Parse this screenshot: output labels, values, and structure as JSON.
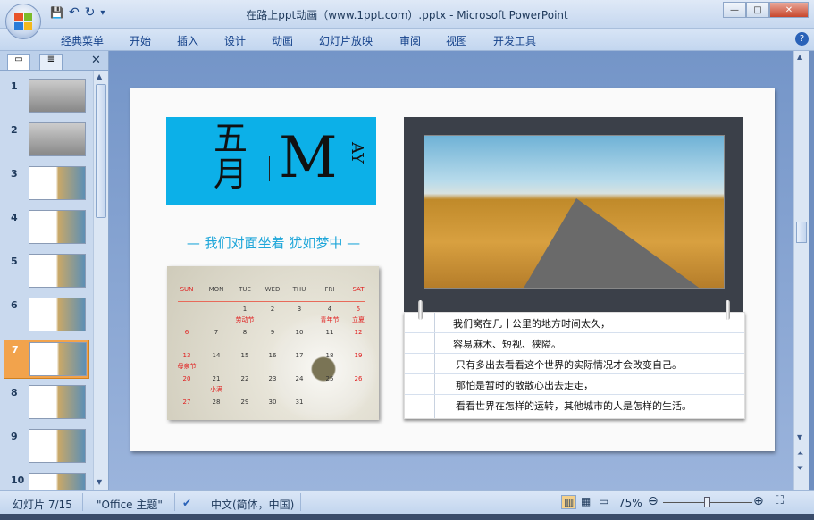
{
  "window": {
    "title": "在路上ppt动画（www.1ppt.com）.pptx - Microsoft PowerPoint",
    "minimize": "—",
    "maximize": "□",
    "close": "✕"
  },
  "qat": {
    "save": "💾",
    "undo": "↶",
    "redo": "↻",
    "more": "▾"
  },
  "ribbon": {
    "tabs": [
      "经典菜单",
      "开始",
      "插入",
      "设计",
      "动画",
      "幻灯片放映",
      "审阅",
      "视图",
      "开发工具"
    ],
    "help": "?"
  },
  "slides_pane": {
    "close": "✕",
    "selected": 7,
    "numbers": [
      "1",
      "2",
      "3",
      "4",
      "5",
      "6",
      "7",
      "8",
      "9",
      "10"
    ]
  },
  "slide": {
    "month_cn": "五月",
    "month_en_big": "M",
    "month_en_small": "AY",
    "tagline": "— 我们对面坐着 犹如梦中 —",
    "calendar": {
      "headers": [
        "SUN",
        "MON",
        "TUE",
        "WED",
        "THU",
        "FRI",
        "SAT"
      ],
      "weeks": [
        [
          "",
          "",
          "1",
          "2",
          "3",
          "4",
          "5"
        ],
        [
          "6",
          "7",
          "8",
          "9",
          "10",
          "11",
          "12"
        ],
        [
          "13",
          "14",
          "15",
          "16",
          "17",
          "18",
          "19"
        ],
        [
          "20",
          "21",
          "22",
          "23",
          "24",
          "25",
          "26"
        ],
        [
          "27",
          "28",
          "29",
          "30",
          "31",
          "",
          ""
        ]
      ],
      "holidays": [
        {
          "day": "1",
          "name": "劳动节"
        },
        {
          "day": "4",
          "name": "青年节"
        },
        {
          "day": "5",
          "name": "立夏"
        },
        {
          "day": "13",
          "name": "母亲节"
        },
        {
          "day": "21",
          "name": "小满"
        }
      ],
      "accent": "#e02020"
    },
    "notes": [
      "我们窝在几十公里的地方时间太久，",
      "容易麻木、短视、狭隘。",
      "只有多出去看看这个世界的实际情况才会改变自己。",
      "那怕是暂时的散散心出去走走，",
      "看看世界在怎样的运转，其他城市的人是怎样的生活。"
    ]
  },
  "status": {
    "slide_info": "幻灯片 7/15",
    "theme": "\"Office 主题\"",
    "language": "中文(简体，中国)",
    "zoom": "75%",
    "zoom_value": 75
  }
}
